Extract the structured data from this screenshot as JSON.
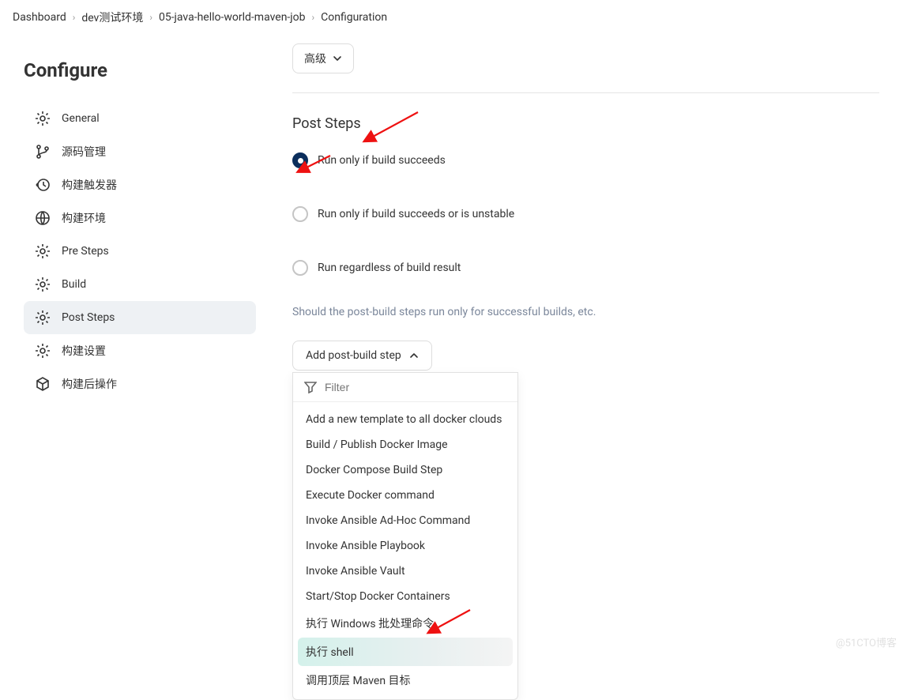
{
  "breadcrumbs": [
    "Dashboard",
    "dev测试环境",
    "05-java-hello-world-maven-job",
    "Configuration"
  ],
  "sidebar": {
    "title": "Configure",
    "items": [
      {
        "label": "General",
        "icon": "gear"
      },
      {
        "label": "源码管理",
        "icon": "branch"
      },
      {
        "label": "构建触发器",
        "icon": "history"
      },
      {
        "label": "构建环境",
        "icon": "globe"
      },
      {
        "label": "Pre Steps",
        "icon": "gear"
      },
      {
        "label": "Build",
        "icon": "gear"
      },
      {
        "label": "Post Steps",
        "icon": "gear",
        "active": true
      },
      {
        "label": "构建设置",
        "icon": "gear"
      },
      {
        "label": "构建后操作",
        "icon": "package"
      }
    ]
  },
  "advanced_label": "高级",
  "section": {
    "title": "Post Steps",
    "radios": [
      {
        "label": "Run only if build succeeds",
        "checked": true
      },
      {
        "label": "Run only if build succeeds or is unstable",
        "checked": false
      },
      {
        "label": "Run regardless of build result",
        "checked": false
      }
    ],
    "help": "Should the post-build steps run only for successful builds, etc."
  },
  "add_button": "Add post-build step",
  "dropdown": {
    "filter_placeholder": "Filter",
    "items": [
      "Add a new template to all docker clouds",
      "Build / Publish Docker Image",
      "Docker Compose Build Step",
      "Execute Docker command",
      "Invoke Ansible Ad-Hoc Command",
      "Invoke Ansible Playbook",
      "Invoke Ansible Vault",
      "Start/Stop Docker Containers",
      "执行 Windows 批处理命令",
      "执行 shell",
      "调用顶层 Maven 目标"
    ],
    "highlight_index": 9
  },
  "watermark": "@51CTO博客"
}
